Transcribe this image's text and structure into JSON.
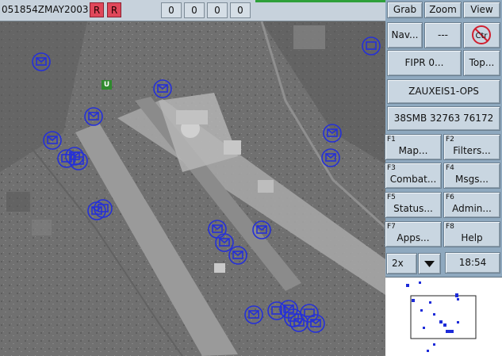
{
  "topbar": {
    "dtg": "051854ZMAY2003",
    "red_buttons": [
      "R",
      "R"
    ],
    "counters": [
      "0",
      "0",
      "0",
      "0"
    ]
  },
  "panel": {
    "grab": "Grab",
    "zoom": "Zoom",
    "view": "View",
    "nav": "Nav...",
    "dashes": "---",
    "ctr": "Ctr",
    "fipr": "FIPR  0...",
    "top": "Top...",
    "unit": "ZAUXEIS1-OPS",
    "unit_badge": "U",
    "grid": "38SMB 32763 76172",
    "fkeys": [
      {
        "key": "F1",
        "label": "Map..."
      },
      {
        "key": "F2",
        "label": "Filters..."
      },
      {
        "key": "F3",
        "label": "Combat..."
      },
      {
        "key": "F4",
        "label": "Msgs..."
      },
      {
        "key": "F5",
        "label": "Status..."
      },
      {
        "key": "F6",
        "label": "Admin..."
      },
      {
        "key": "F7",
        "label": "Apps..."
      },
      {
        "key": "F8",
        "label": "Help"
      }
    ],
    "scale": "2x",
    "time": "18:54"
  },
  "colors": {
    "symbol": "#2530d8",
    "alert_red": "#e0475a",
    "panel_bg": "#8fa9bf",
    "button_bg": "#c9d6e1",
    "badge_green": "#2f8a2e"
  },
  "icons": {
    "ctr": "no-entry-icon",
    "dropdown": "triangle-down-icon",
    "map_symbols": "unit-symbol-icon"
  }
}
